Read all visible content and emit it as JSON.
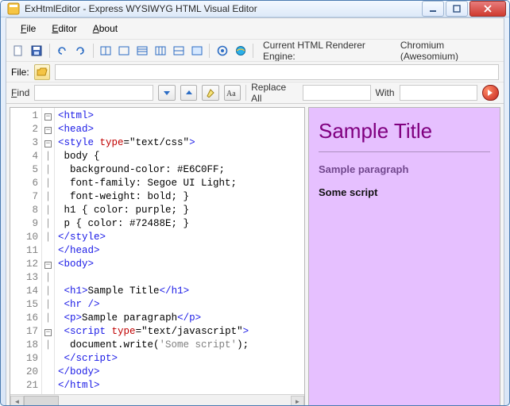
{
  "window": {
    "title": "ExHtmlEditor - Express WYSIWYG HTML Visual Editor"
  },
  "menubar": {
    "items": [
      "File",
      "Editor",
      "About"
    ]
  },
  "toolbar": {
    "engine_label": "Current HTML Renderer Engine:",
    "engine_value": "Chromium (Awesomium)"
  },
  "filebar": {
    "label": "File:",
    "value": ""
  },
  "findbar": {
    "find_label": "Find",
    "find_value": "",
    "replace_label": "Replace All",
    "replace_value": "",
    "with_label": "With",
    "with_value": ""
  },
  "editor": {
    "line_count": 21,
    "lines": [
      "<html>",
      "<head>",
      "<style type=\"text/css\">",
      " body {",
      "  background-color: #E6C0FF;",
      "  font-family: Segoe UI Light;",
      "  font-weight: bold; }",
      " h1 { color: purple; }",
      " p { color: #72488E; }",
      "</style>",
      "</head>",
      "<body>",
      "",
      " <h1>Sample Title</h1>",
      " <hr />",
      " <p>Sample paragraph</p>",
      " <script type=\"text/javascript\">",
      "  document.write('Some script');",
      " </script>",
      "</body>",
      "</html>"
    ],
    "fold_markers": {
      "1": "-",
      "2": "-",
      "3": "-",
      "11": "",
      "12": "-",
      "17": "-",
      "19": "",
      "20": "",
      "21": ""
    }
  },
  "preview": {
    "title": "Sample Title",
    "paragraph": "Sample paragraph",
    "script_output": "Some script"
  },
  "colors": {
    "preview_bg": "#E6C0FF",
    "h1": "purple",
    "p": "#72488E"
  }
}
